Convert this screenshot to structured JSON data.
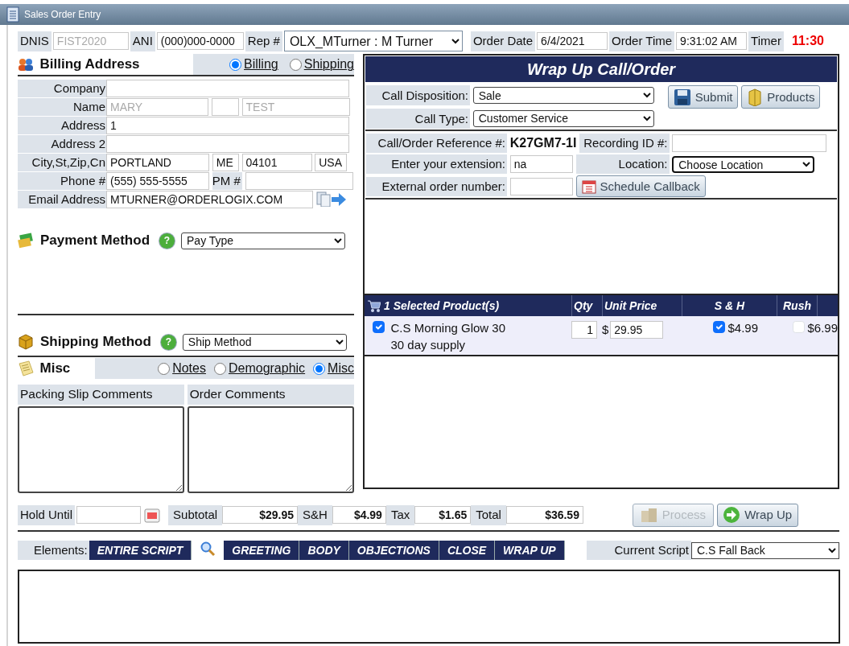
{
  "window": {
    "title": "Sales Order Entry"
  },
  "header": {
    "dnis_label": "DNIS",
    "dnis_placeholder": "FIST2020",
    "ani_label": "ANI",
    "ani": "(000)000-0000",
    "rep_label": "Rep #",
    "rep": "OLX_MTurner : M Turner",
    "order_date_label": "Order Date",
    "order_date": "6/4/2021",
    "order_time_label": "Order Time",
    "order_time": "9:31:02 AM",
    "timer_label": "Timer",
    "timer": "11:30"
  },
  "billing": {
    "title": "Billing Address",
    "address_options": [
      {
        "label": "Billing",
        "selected": true
      },
      {
        "label": "Shipping",
        "selected": false
      }
    ],
    "rows": [
      {
        "kind": "text",
        "label": "Company"
      },
      {
        "kind": "name",
        "label": "Name",
        "first_placeholder": "MARY",
        "last_placeholder": "TEST"
      },
      {
        "kind": "text",
        "label": "Address",
        "value": "1"
      },
      {
        "kind": "text",
        "label": "Address 2"
      },
      {
        "kind": "city",
        "label": "City,St,Zip,Cn",
        "city": "PORTLAND",
        "state": "ME",
        "zip": "04101",
        "country": "USA"
      },
      {
        "kind": "phone",
        "label": "Phone #",
        "value": "(555) 555-5555",
        "pm_label": "PM #"
      },
      {
        "kind": "email",
        "label": "Email Address",
        "value": "MTURNER@ORDERLOGIX.COM"
      }
    ]
  },
  "payment": {
    "title": "Payment Method",
    "help": "?",
    "select": "Pay Type"
  },
  "shipping": {
    "title": "Shipping Method",
    "help": "?",
    "select": "Ship Method"
  },
  "misc": {
    "title": "Misc",
    "options": [
      {
        "label": "Notes",
        "selected": false
      },
      {
        "label": "Demographic",
        "selected": false
      },
      {
        "label": "Misc",
        "selected": true
      }
    ],
    "packing_label": "Packing Slip Comments",
    "order_label": "Order Comments"
  },
  "wrap_up": {
    "title": "Wrap Up Call/Order",
    "disposition_label": "Call Disposition:",
    "disposition": "Sale",
    "call_type_label": "Call Type:",
    "call_type": "Customer Service",
    "submit": "Submit",
    "products": "Products",
    "reference_label": "Call/Order Reference #:",
    "reference": "K27GM7-1I",
    "recording_label": "Recording ID #:",
    "extension_label": "Enter your extension:",
    "extension": "na",
    "location_label": "Location:",
    "location": "Choose Location",
    "external_label": "External order number:",
    "callback": "Schedule Callback"
  },
  "products": {
    "columns": [
      "1 Selected Product(s)",
      "Qty",
      "Unit Price",
      "S & H",
      "Rush"
    ],
    "rows": [
      {
        "selected": true,
        "name": "C.S Morning Glow 30",
        "description": "30 day supply",
        "qty": "1",
        "currency": "$",
        "price": "29.95",
        "sh": "$4.99",
        "sh_checked": true,
        "rush": "$6.99",
        "rush_checked": false
      }
    ]
  },
  "totals": {
    "hold_label": "Hold Until",
    "subtotal_label": "Subtotal",
    "subtotal": "$29.95",
    "sh_label": "S&H",
    "sh": "$4.99",
    "tax_label": "Tax",
    "tax": "$1.65",
    "total_label": "Total",
    "total": "$36.59",
    "buttons": [
      {
        "kind": "process",
        "label": "Process",
        "disabled": true
      },
      {
        "kind": "wrap",
        "label": "Wrap Up",
        "disabled": false
      }
    ]
  },
  "script": {
    "elements_label": "Elements:",
    "tabs": [
      "ENTIRE SCRIPT",
      "GREETING",
      "BODY",
      "OBJECTIONS",
      "CLOSE",
      "WRAP UP"
    ],
    "current_label": "Current Script",
    "current": "C.S Fall Back"
  }
}
